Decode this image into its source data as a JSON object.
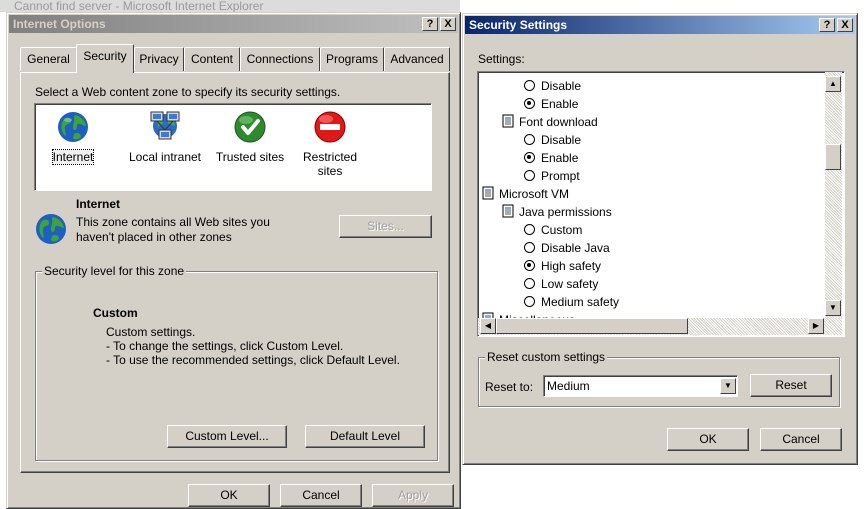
{
  "background": {
    "title": "Cannot find server - Microsoft Internet Explorer"
  },
  "internet_options": {
    "title": "Internet Options",
    "help_btn": "?",
    "close_btn": "X",
    "tabs": [
      {
        "label": "General"
      },
      {
        "label": "Security"
      },
      {
        "label": "Privacy"
      },
      {
        "label": "Content"
      },
      {
        "label": "Connections"
      },
      {
        "label": "Programs"
      },
      {
        "label": "Advanced"
      }
    ],
    "active_tab": "Security",
    "instruction": "Select a Web content zone to specify its security settings.",
    "zones": [
      {
        "label": "Internet",
        "icon": "globe-icon"
      },
      {
        "label": "Local intranet",
        "icon": "network-icon"
      },
      {
        "label": "Trusted sites",
        "icon": "checkmark-icon"
      },
      {
        "label": "Restricted sites",
        "icon": "no-entry-icon"
      }
    ],
    "selected_zone": {
      "name": "Internet",
      "description_line1": "This zone contains all Web sites you",
      "description_line2": "haven't placed in other zones",
      "sites_button": "Sites..."
    },
    "security_level": {
      "legend": "Security level for this zone",
      "level_name": "Custom",
      "line1": "Custom settings.",
      "line2": "- To change the settings, click Custom Level.",
      "line3": "- To use the recommended settings, click Default Level.",
      "custom_level_button": "Custom Level...",
      "default_level_button": "Default Level"
    },
    "buttons": {
      "ok": "OK",
      "cancel": "Cancel",
      "apply": "Apply"
    }
  },
  "security_settings": {
    "title": "Security Settings",
    "help_btn": "?",
    "close_btn": "X",
    "settings_label": "Settings:",
    "tree": [
      {
        "type": "radio",
        "label": "Disable",
        "checked": false,
        "indent": 2
      },
      {
        "type": "radio",
        "label": "Enable",
        "checked": true,
        "indent": 2
      },
      {
        "type": "node",
        "label": "Font download",
        "indent": 1
      },
      {
        "type": "radio",
        "label": "Disable",
        "checked": false,
        "indent": 2
      },
      {
        "type": "radio",
        "label": "Enable",
        "checked": true,
        "indent": 2
      },
      {
        "type": "radio",
        "label": "Prompt",
        "checked": false,
        "indent": 2
      },
      {
        "type": "node",
        "label": "Microsoft VM",
        "indent": 0
      },
      {
        "type": "node",
        "label": "Java permissions",
        "indent": 1
      },
      {
        "type": "radio",
        "label": "Custom",
        "checked": false,
        "indent": 2
      },
      {
        "type": "radio",
        "label": "Disable Java",
        "checked": false,
        "indent": 2
      },
      {
        "type": "radio",
        "label": "High safety",
        "checked": true,
        "indent": 2
      },
      {
        "type": "radio",
        "label": "Low safety",
        "checked": false,
        "indent": 2
      },
      {
        "type": "radio",
        "label": "Medium safety",
        "checked": false,
        "indent": 2
      },
      {
        "type": "node",
        "label": "Miscellaneous",
        "indent": 0
      }
    ],
    "reset": {
      "legend": "Reset custom settings",
      "label": "Reset to:",
      "value": "Medium",
      "reset_button": "Reset"
    },
    "buttons": {
      "ok": "OK",
      "cancel": "Cancel"
    }
  }
}
